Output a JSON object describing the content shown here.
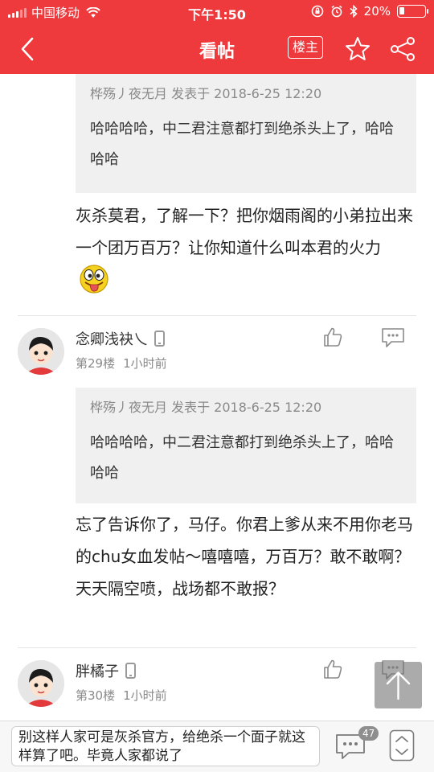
{
  "status_bar": {
    "carrier": "中国移动",
    "time": "下午1:50",
    "battery": "20%",
    "battery_level": 0.2
  },
  "nav": {
    "title": "看帖",
    "owner_label": "楼主"
  },
  "posts": [
    {
      "quote_meta": "桦殇丿夜无月 发表于 2018-6-25 12:20",
      "quote_text": "哈哈哈哈，中二君注意都打到绝杀头上了，哈哈哈哈",
      "reply_text": "灰杀莫君，了解一下？把你烟雨阁的小弟拉出来一个团万百万？让你知道什么叫本君的火力"
    },
    {
      "username": "念卿浅袂乀",
      "floor": "第29楼",
      "time": "1小时前",
      "quote_meta": "桦殇丿夜无月 发表于 2018-6-25 12:20",
      "quote_text": "哈哈哈哈，中二君注意都打到绝杀头上了，哈哈哈哈",
      "reply_text": "忘了告诉你了，马仔。你君上爹从来不用你老马的chu女血发帖～嘻嘻嘻，万百万？敢不敢啊？天天隔空喷，战场都不敢报？"
    },
    {
      "username": "胖橘子",
      "floor": "第30楼",
      "time": "1小时前"
    }
  ],
  "bottom": {
    "draft_text": "别这样人家可是灰杀官方，给绝杀一个面子就这样算了吧。毕竟人家都说了",
    "comment_count": "47"
  }
}
